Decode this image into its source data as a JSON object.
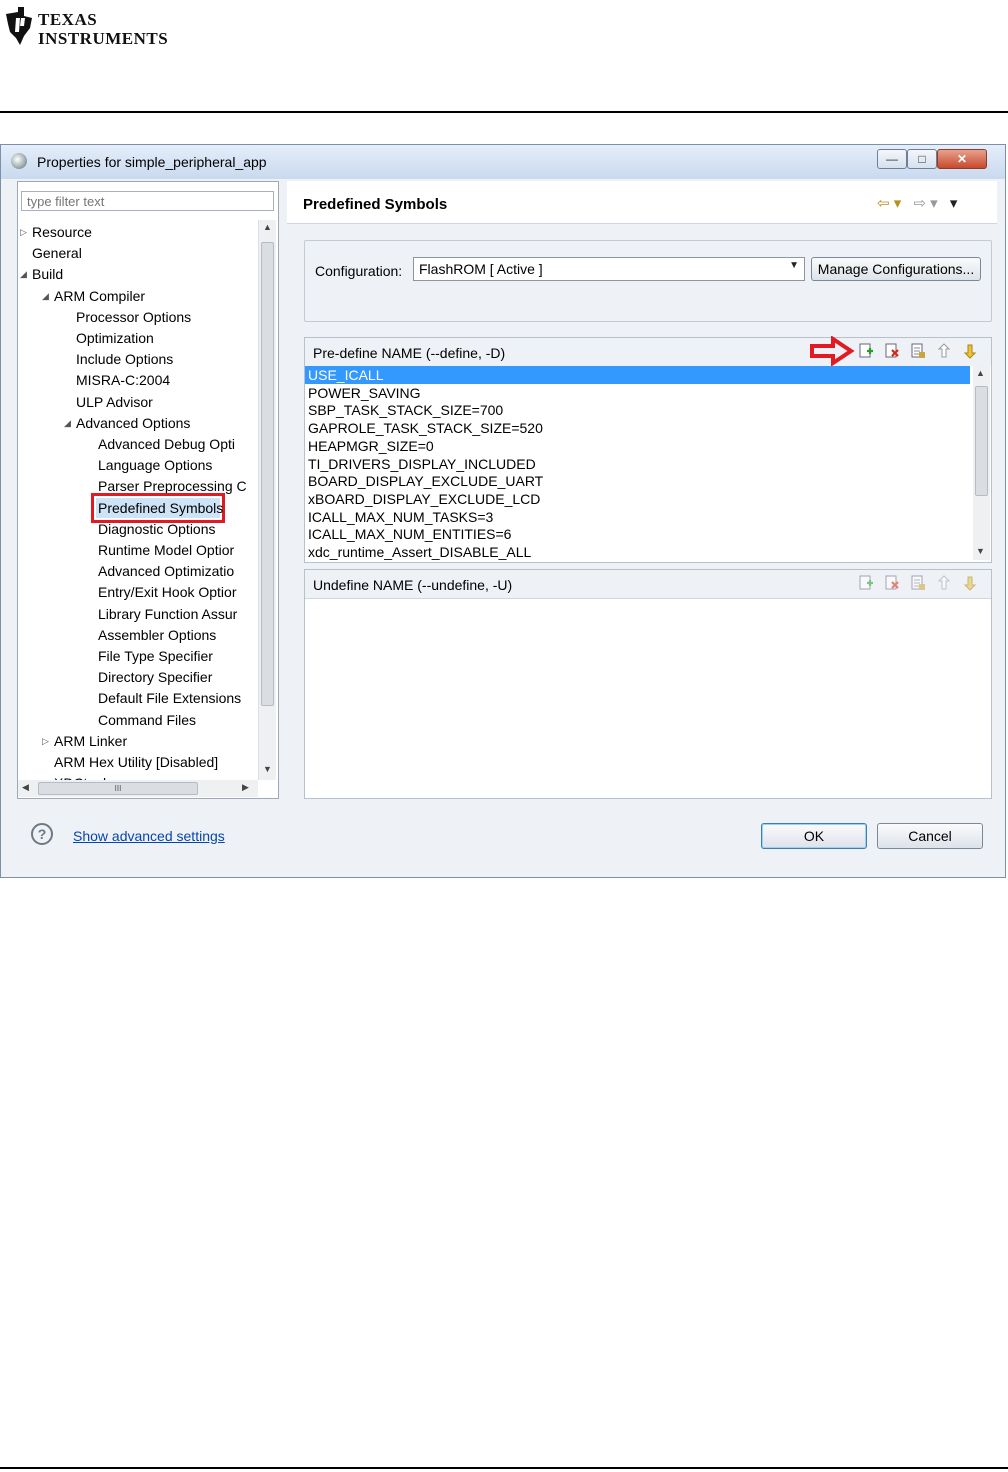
{
  "doc_header": {
    "brand_line1": "TEXAS",
    "brand_line2": "INSTRUMENTS"
  },
  "dialog": {
    "title": "Properties for simple_peripheral_app",
    "window_buttons": {
      "minimize": "—",
      "maximize": "□",
      "close": "✕"
    }
  },
  "left_pane": {
    "filter_placeholder": "type filter text",
    "tree": [
      {
        "label": "Resource",
        "level": 0,
        "twisty": "collapsed"
      },
      {
        "label": "General",
        "level": 0,
        "twisty": "none"
      },
      {
        "label": "Build",
        "level": 0,
        "twisty": "expanded"
      },
      {
        "label": "ARM Compiler",
        "level": 1,
        "twisty": "expanded"
      },
      {
        "label": "Processor Options",
        "level": 2,
        "twisty": "none"
      },
      {
        "label": "Optimization",
        "level": 2,
        "twisty": "none"
      },
      {
        "label": "Include Options",
        "level": 2,
        "twisty": "none"
      },
      {
        "label": "MISRA-C:2004",
        "level": 2,
        "twisty": "none"
      },
      {
        "label": "ULP Advisor",
        "level": 2,
        "twisty": "none"
      },
      {
        "label": "Advanced Options",
        "level": 2,
        "twisty": "expanded"
      },
      {
        "label": "Advanced Debug Opti",
        "level": 3,
        "twisty": "none"
      },
      {
        "label": "Language Options",
        "level": 3,
        "twisty": "none"
      },
      {
        "label": "Parser Preprocessing C",
        "level": 3,
        "twisty": "none"
      },
      {
        "label": "Predefined Symbols",
        "level": 3,
        "twisty": "none",
        "selected": true
      },
      {
        "label": "Diagnostic Options",
        "level": 3,
        "twisty": "none"
      },
      {
        "label": "Runtime Model Optior",
        "level": 3,
        "twisty": "none"
      },
      {
        "label": "Advanced Optimizatio",
        "level": 3,
        "twisty": "none"
      },
      {
        "label": "Entry/Exit Hook Optior",
        "level": 3,
        "twisty": "none"
      },
      {
        "label": "Library Function Assur",
        "level": 3,
        "twisty": "none"
      },
      {
        "label": "Assembler Options",
        "level": 3,
        "twisty": "none"
      },
      {
        "label": "File Type Specifier",
        "level": 3,
        "twisty": "none"
      },
      {
        "label": "Directory Specifier",
        "level": 3,
        "twisty": "none"
      },
      {
        "label": "Default File Extensions",
        "level": 3,
        "twisty": "none"
      },
      {
        "label": "Command Files",
        "level": 3,
        "twisty": "none"
      },
      {
        "label": "ARM Linker",
        "level": 1,
        "twisty": "collapsed"
      },
      {
        "label": "ARM Hex Utility  [Disabled]",
        "level": 1,
        "twisty": "none"
      },
      {
        "label": "XDCtools",
        "level": 1,
        "twisty": "collapsed"
      }
    ],
    "hscroll_thumb": "III"
  },
  "page": {
    "title": "Predefined Symbols",
    "nav_back": "⇦ ▾",
    "nav_forward": "⇨ ▾",
    "nav_menu": "▾"
  },
  "configuration": {
    "label": "Configuration:",
    "value": "FlashROM  [ Active ]",
    "manage_label": "Manage Configurations..."
  },
  "predefine": {
    "title": "Pre-define NAME (--define, -D)",
    "items": [
      "USE_ICALL",
      "POWER_SAVING",
      "SBP_TASK_STACK_SIZE=700",
      "GAPROLE_TASK_STACK_SIZE=520",
      "HEAPMGR_SIZE=0",
      "TI_DRIVERS_DISPLAY_INCLUDED",
      "BOARD_DISPLAY_EXCLUDE_UART",
      "xBOARD_DISPLAY_EXCLUDE_LCD",
      "ICALL_MAX_NUM_TASKS=3",
      "ICALL_MAX_NUM_ENTITIES=6",
      "xdc_runtime_Assert_DISABLE_ALL"
    ],
    "selected_index": 0
  },
  "undefine": {
    "title": "Undefine NAME (--undefine, -U)",
    "items": []
  },
  "tool_icons": [
    "add-icon",
    "delete-icon",
    "edit-icon",
    "move-up-icon",
    "move-down-icon"
  ],
  "colors": {
    "highlight_box": "#e21a24",
    "selection": "#3399ff",
    "link": "#0645ad"
  },
  "footer": {
    "help_glyph": "?",
    "advanced_link": "Show advanced settings",
    "ok_label": "OK",
    "cancel_label": "Cancel"
  }
}
